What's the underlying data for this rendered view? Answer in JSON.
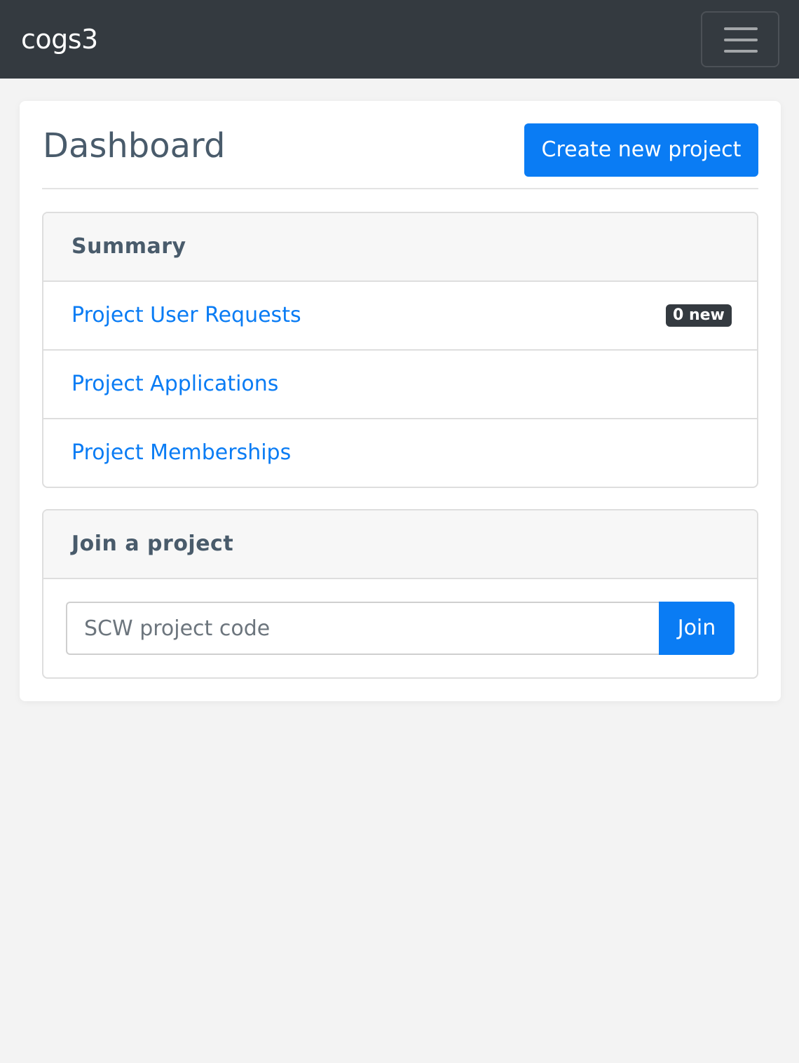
{
  "navbar": {
    "brand": "cogs3",
    "toggler_icon": "hamburger-menu-icon"
  },
  "dashboard": {
    "title": "Dashboard",
    "create_button_label": "Create new project"
  },
  "summary": {
    "heading": "Summary",
    "items": [
      {
        "label": "Project User Requests",
        "badge": "0 new"
      },
      {
        "label": "Project Applications"
      },
      {
        "label": "Project Memberships"
      }
    ]
  },
  "join": {
    "heading": "Join a project",
    "input_placeholder": "SCW project code",
    "input_value": "",
    "button_label": "Join"
  },
  "colors": {
    "navbar_bg": "#343a40",
    "primary": "#0a7cf4",
    "page_bg": "#f3f3f3",
    "heading_text": "#495b6b",
    "badge_bg": "#343a40"
  }
}
